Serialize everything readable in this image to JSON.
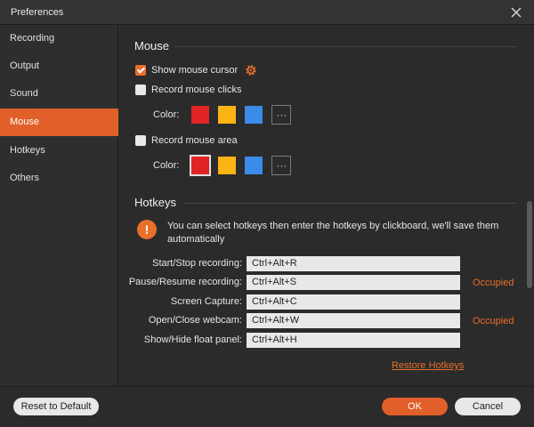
{
  "window": {
    "title": "Preferences"
  },
  "sidebar": {
    "items": [
      {
        "label": "Recording"
      },
      {
        "label": "Output"
      },
      {
        "label": "Sound"
      },
      {
        "label": "Mouse",
        "active": true
      },
      {
        "label": "Hotkeys"
      },
      {
        "label": "Others"
      }
    ]
  },
  "mouse": {
    "section_title": "Mouse",
    "show_cursor": {
      "label": "Show mouse cursor",
      "checked": true
    },
    "record_clicks": {
      "label": "Record mouse clicks",
      "checked": false
    },
    "record_area": {
      "label": "Record mouse area",
      "checked": false
    },
    "color_label": "Color:",
    "more_label": "···",
    "colors": {
      "red": "#e02424",
      "yellow": "#fbb416",
      "blue": "#3b8be8"
    }
  },
  "hotkeys": {
    "section_title": "Hotkeys",
    "info_icon": "!",
    "info_text": "You can select hotkeys then enter the hotkeys by clickboard, we'll save them automatically",
    "rows": [
      {
        "label": "Start/Stop recording:",
        "value": "Ctrl+Alt+R",
        "status": ""
      },
      {
        "label": "Pause/Resume recording:",
        "value": "Ctrl+Alt+S",
        "status": "Occupied"
      },
      {
        "label": "Screen Capture:",
        "value": "Ctrl+Alt+C",
        "status": ""
      },
      {
        "label": "Open/Close webcam:",
        "value": "Ctrl+Alt+W",
        "status": "Occupied"
      },
      {
        "label": "Show/Hide float panel:",
        "value": "Ctrl+Alt+H",
        "status": ""
      }
    ],
    "restore_label": "Restore Hotkeys"
  },
  "footer": {
    "reset_label": "Reset to Default",
    "ok_label": "OK",
    "cancel_label": "Cancel"
  },
  "theme": {
    "accent": "#e15f29",
    "background": "#2b2b2b"
  }
}
